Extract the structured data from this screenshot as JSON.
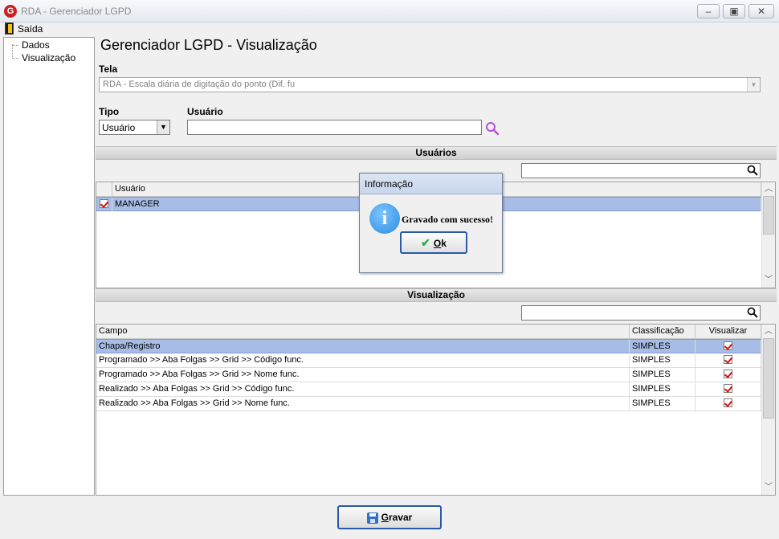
{
  "window": {
    "logo_letter": "G",
    "title": "RDA - Gerenciador LGPD",
    "min_glyph": "‒",
    "max_glyph": "▣",
    "close_glyph": "✕"
  },
  "menu": {
    "items": [
      {
        "label": "Saída"
      }
    ]
  },
  "tree": {
    "items": [
      {
        "label": "Dados"
      },
      {
        "label": "Visualização"
      }
    ]
  },
  "main": {
    "title": "Gerenciador LGPD - Visualização",
    "tela_label": "Tela",
    "tela_value": "RDA - Escala diária de digitação do ponto (Dif. fu",
    "tipo_label": "Tipo",
    "tipo_value": "Usuário",
    "usuario_label": "Usuário",
    "usuario_value": ""
  },
  "users_section": {
    "title": "Usuários",
    "search_value": "",
    "columns": [
      "Usuário"
    ],
    "rows": [
      {
        "checked": true,
        "name": "MANAGER"
      }
    ]
  },
  "view_section": {
    "title": "Visualização",
    "search_value": "",
    "columns": [
      "Campo",
      "Classificação",
      "Visualizar"
    ],
    "rows": [
      {
        "campo": "Chapa/Registro",
        "classificacao": "SIMPLES",
        "visualizar": true
      },
      {
        "campo": "Programado >> Aba Folgas >> Grid >> Código func.",
        "classificacao": "SIMPLES",
        "visualizar": true
      },
      {
        "campo": "Programado >> Aba Folgas >> Grid >> Nome func.",
        "classificacao": "SIMPLES",
        "visualizar": true
      },
      {
        "campo": "Realizado >> Aba Folgas >> Grid >> Código func.",
        "classificacao": "SIMPLES",
        "visualizar": true
      },
      {
        "campo": "Realizado >> Aba Folgas >> Grid >> Nome func.",
        "classificacao": "SIMPLES",
        "visualizar": true
      }
    ]
  },
  "footer": {
    "save_first": "G",
    "save_rest": "ravar"
  },
  "dialog": {
    "title": "Informação",
    "icon_letter": "i",
    "message": "Gravado com sucesso!",
    "ok_first": "O",
    "ok_rest": "k"
  },
  "colors": {
    "accent": "#2a5aa8",
    "selected_row": "#a8bde6",
    "check": "#d01010"
  }
}
